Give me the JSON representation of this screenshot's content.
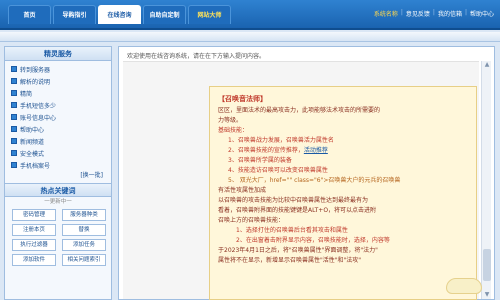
{
  "nav": {
    "tabs": [
      {
        "label": "首页"
      },
      {
        "label": "导购指引"
      },
      {
        "label": "在线咨询"
      },
      {
        "label": "自助自定制"
      },
      {
        "label": "网站大师"
      }
    ],
    "links": [
      {
        "label": "系统名称"
      },
      {
        "label": "意见反馈"
      },
      {
        "label": "我的信箱"
      },
      {
        "label": "帮助中心"
      }
    ]
  },
  "sidebar": {
    "title": "精灵服务",
    "items": [
      {
        "label": "转到服务器"
      },
      {
        "label": "解析的说明"
      },
      {
        "label": "精简"
      },
      {
        "label": "手机短信多少"
      },
      {
        "label": "账号信息中心"
      },
      {
        "label": "帮助中心"
      },
      {
        "label": "新闻频道"
      },
      {
        "label": "安全模式"
      },
      {
        "label": "手机档案号"
      }
    ],
    "more": "[换一批]",
    "keywords_title": "热点关键词",
    "keywords_sub": "一更新中一",
    "keywords": [
      {
        "label": "密码管理"
      },
      {
        "label": "服务器种类"
      },
      {
        "label": "注册本页"
      },
      {
        "label": "替换"
      },
      {
        "label": "执行过滤器"
      },
      {
        "label": "添加任务"
      },
      {
        "label": "添加软件"
      },
      {
        "label": "相关问题索引"
      }
    ]
  },
  "main": {
    "welcome": "欢迎使用在线咨询系统，请在在下方输入提问内容。",
    "reply": {
      "title": "【召唤音法师】",
      "lines": [
        {
          "text": "  区区，里面法术的最高攻击力，此项能够法术攻击的所需要的",
          "cls": "dark"
        },
        {
          "text": "力等级。",
          "cls": "dark"
        },
        {
          "text": "  基础技能：",
          "cls": ""
        },
        {
          "text": "1、召唤兽战力发展，召唤兽活力属性名",
          "cls": "indent"
        },
        {
          "text": "2、召唤兽技能的宣传推荐，",
          "cls": "indent",
          "link": "活动推荐"
        },
        {
          "text": "3、召唤兽所学属的装备",
          "cls": "indent"
        },
        {
          "text": "4、技能造访召唤可以改变召唤兽属性",
          "cls": "indent"
        },
        {
          "text": "5、 双光大厂，href=\"\" class=\"6\">召唤兽大户的元兵的召唤兽",
          "cls": "indent brown"
        },
        {
          "text": "有活性攻属性加成",
          "cls": "dark"
        },
        {
          "text": "  以召唤兽的攻击技能为比较中召唤兽属性达到最终最有为",
          "cls": "dark"
        },
        {
          "text": "看着，召唤兽附界面的技能键键是ALT+O，将可以点击进附",
          "cls": "dark"
        },
        {
          "text": "召唤上方的召唤兽技能：",
          "cls": "dark"
        },
        {
          "text": "1、选择打住的召唤兽后台看其攻击和属性",
          "cls": "indent2"
        },
        {
          "text": "2、在出窗着击附界显示内容，召唤技能时，选择，内容等",
          "cls": "indent2"
        },
        {
          "text": "于2023年4月1日之后，将\"召唤兽属性\"界面调整，将\"法力\"",
          "cls": "dark"
        },
        {
          "text": "属性将不在显示，新增显示召唤兽属性\"活性\"和\"法攻\"",
          "cls": "dark"
        }
      ]
    }
  },
  "colors": {
    "nav_bg": "#1a63b0",
    "accent": "#2f82d1",
    "reply_bg": "#fff7da",
    "reply_text": "#c0392b"
  }
}
